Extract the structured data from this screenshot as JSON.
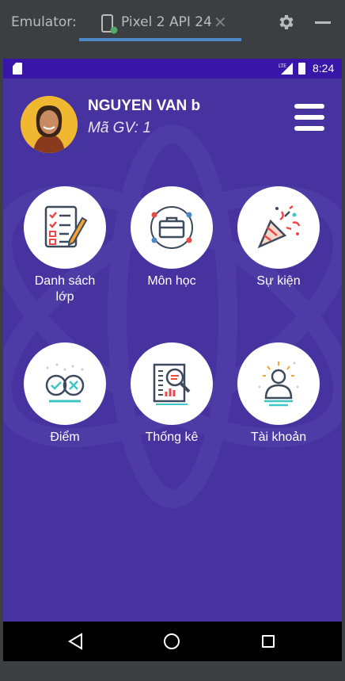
{
  "emulator": {
    "label": "Emulator:",
    "tab_label": "Pixel 2 API 24",
    "close_glyph": "✕",
    "settings_icon": "gear-icon",
    "minimize_icon": "minimize-icon"
  },
  "status_bar": {
    "network": "LTE",
    "time": "8:24"
  },
  "profile": {
    "name": "NGUYEN VAN b",
    "code": "Mã GV: 1"
  },
  "menu": {
    "icon": "hamburger-menu-icon"
  },
  "tiles": [
    {
      "label": "Danh sách\nlớp",
      "icon": "checklist-icon"
    },
    {
      "label": "Môn học",
      "icon": "briefcase-icon"
    },
    {
      "label": "Sự kiện",
      "icon": "party-popper-icon"
    },
    {
      "label": "Điểm",
      "icon": "grades-icon"
    },
    {
      "label": "Thống kê",
      "icon": "statistics-icon"
    },
    {
      "label": "Tài khoản",
      "icon": "account-icon"
    }
  ],
  "colors": {
    "status_bar": "#3816a8",
    "app_background": "#4633a0",
    "accent": "#4a88c7"
  }
}
